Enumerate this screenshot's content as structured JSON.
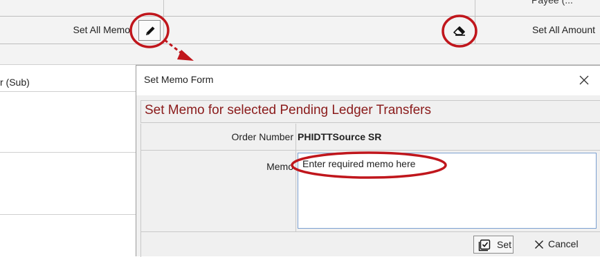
{
  "grid": {
    "payee_header_partial": "Payee (...",
    "set_all_memo_label": "Set All Memo",
    "set_all_amount_label": "Set All Amount",
    "sub_column_label": "r (Sub)"
  },
  "dialog": {
    "title": "Set Memo Form",
    "heading": "Set Memo for selected Pending Ledger Transfers",
    "order_number_label": "Order Number",
    "order_number_value": "PHIDTTSource SR",
    "memo_label": "Memo",
    "memo_value": "Enter required memo here",
    "set_button_label": "Set",
    "cancel_button_label": "Cancel"
  },
  "icons": {
    "set_all_memo": "pencil-icon",
    "set_all_amount": "eraser-icon",
    "close": "close-icon",
    "set": "checkbox-icon",
    "cancel": "x-icon"
  },
  "colors": {
    "heading_text": "#8a1a1a",
    "annotation_red": "#c0161c",
    "textarea_border": "#7a9fd0"
  }
}
